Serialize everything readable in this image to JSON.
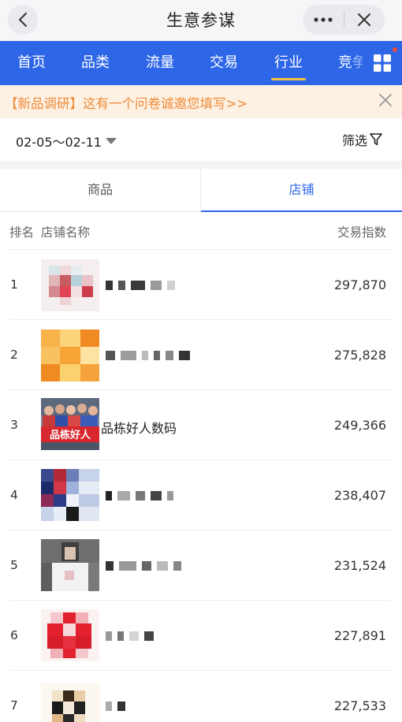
{
  "titlebar": {
    "title": "生意参谋",
    "back_icon": "chevron-left-icon",
    "more_icon": "more-dots-icon",
    "close_icon": "close-icon"
  },
  "nav": {
    "tabs": [
      {
        "label": "首页",
        "active": false
      },
      {
        "label": "品类",
        "active": false
      },
      {
        "label": "流量",
        "active": false
      },
      {
        "label": "交易",
        "active": false
      },
      {
        "label": "行业",
        "active": true
      },
      {
        "label": "竞争",
        "active": false
      }
    ],
    "grid_icon": "grid-menu-icon",
    "accent_color": "#2e66e8",
    "active_underline_color": "#f6c445"
  },
  "notice": {
    "text": "【新品调研】这有一个问卷诚邀您填写>>",
    "text_color": "#ef8b3a",
    "background": "#fdf1e3"
  },
  "date_filter": {
    "range": "02-05～02-11",
    "filter_label": "筛选",
    "filter_icon": "funnel-icon"
  },
  "subtabs": [
    {
      "label": "商品",
      "active": false
    },
    {
      "label": "店铺",
      "active": true
    }
  ],
  "table": {
    "headers": {
      "rank": "排名",
      "name": "店铺名称",
      "value": "交易指数"
    },
    "rows": [
      {
        "rank": "1",
        "name": "",
        "value": "297,870"
      },
      {
        "rank": "2",
        "name": "",
        "value": "275,828"
      },
      {
        "rank": "3",
        "name": "品栋好人数码",
        "value": "249,366"
      },
      {
        "rank": "4",
        "name": "",
        "value": "238,407"
      },
      {
        "rank": "5",
        "name": "",
        "value": "231,524"
      },
      {
        "rank": "6",
        "name": "",
        "value": "227,891"
      },
      {
        "rank": "7",
        "name": "",
        "value": "227,533"
      }
    ],
    "logo_banner_text": "品栋好人"
  }
}
